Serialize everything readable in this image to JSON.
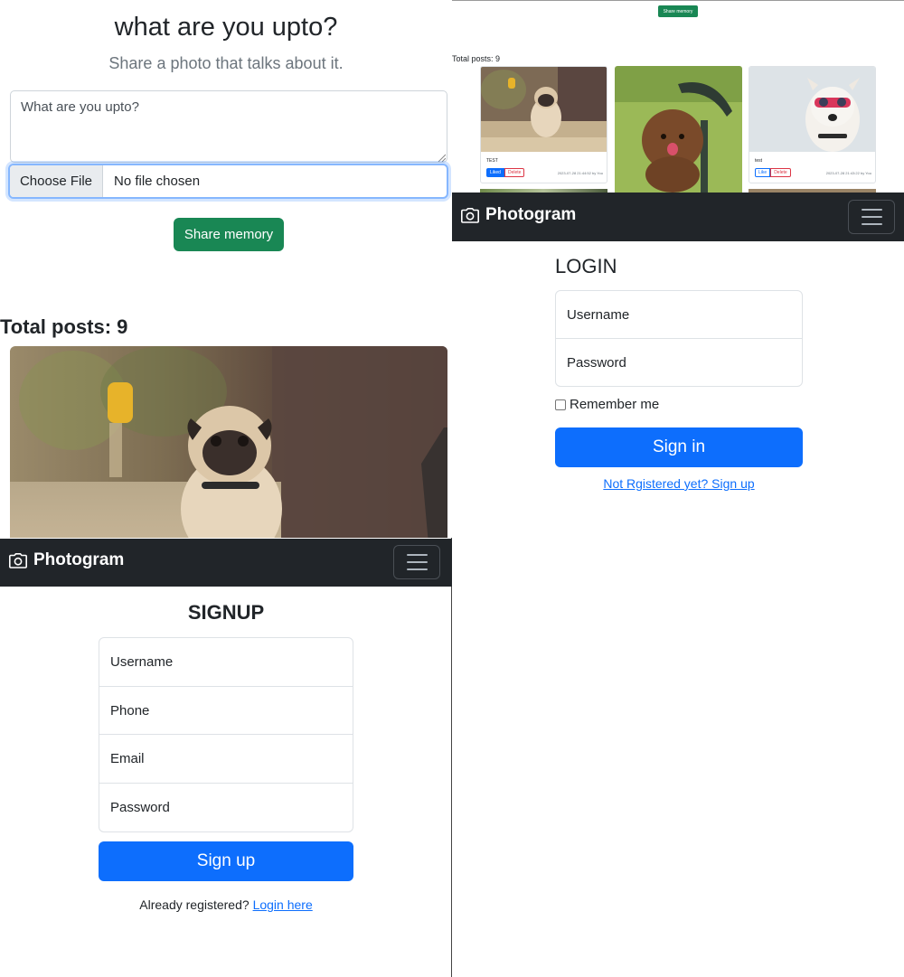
{
  "app": {
    "brand": "Photogram"
  },
  "share": {
    "heading": "what are you upto?",
    "subheading": "Share a photo that talks about it.",
    "textarea_placeholder": "What are you upto?",
    "file_button": "Choose File",
    "file_status": "No file chosen",
    "share_button": "Share memory"
  },
  "feed": {
    "total_label": "Total posts: 9",
    "cards": [
      {
        "caption": "TEST",
        "like_label": "Liked",
        "delete_label": "Delete",
        "meta": "2023-07-28 21:44:52 by You",
        "liked": true,
        "photo": "pug-photo"
      },
      {
        "caption": "",
        "like_label": "",
        "delete_label": "",
        "meta": "",
        "liked": false,
        "photo": "poodle-photo"
      },
      {
        "caption": "test",
        "like_label": "Like",
        "delete_label": "Delete",
        "meta": "2023-07-28 21:43:22 by You",
        "liked": false,
        "photo": "dog-goggles-photo"
      }
    ]
  },
  "login": {
    "title": "LOGIN",
    "username_placeholder": "Username",
    "password_placeholder": "Password",
    "remember_label": "Remember me",
    "submit": "Sign in",
    "signup_link": "Not Rgistered yet? Sign up"
  },
  "signup": {
    "title": "SIGNUP",
    "username_placeholder": "Username",
    "phone_placeholder": "Phone",
    "email_placeholder": "Email",
    "password_placeholder": "Password",
    "submit": "Sign up",
    "already_text": "Already registered?",
    "login_link": "Login here"
  },
  "colors": {
    "navbar": "#212529",
    "primary": "#0d6efd",
    "success": "#198754",
    "danger": "#dc3545"
  }
}
